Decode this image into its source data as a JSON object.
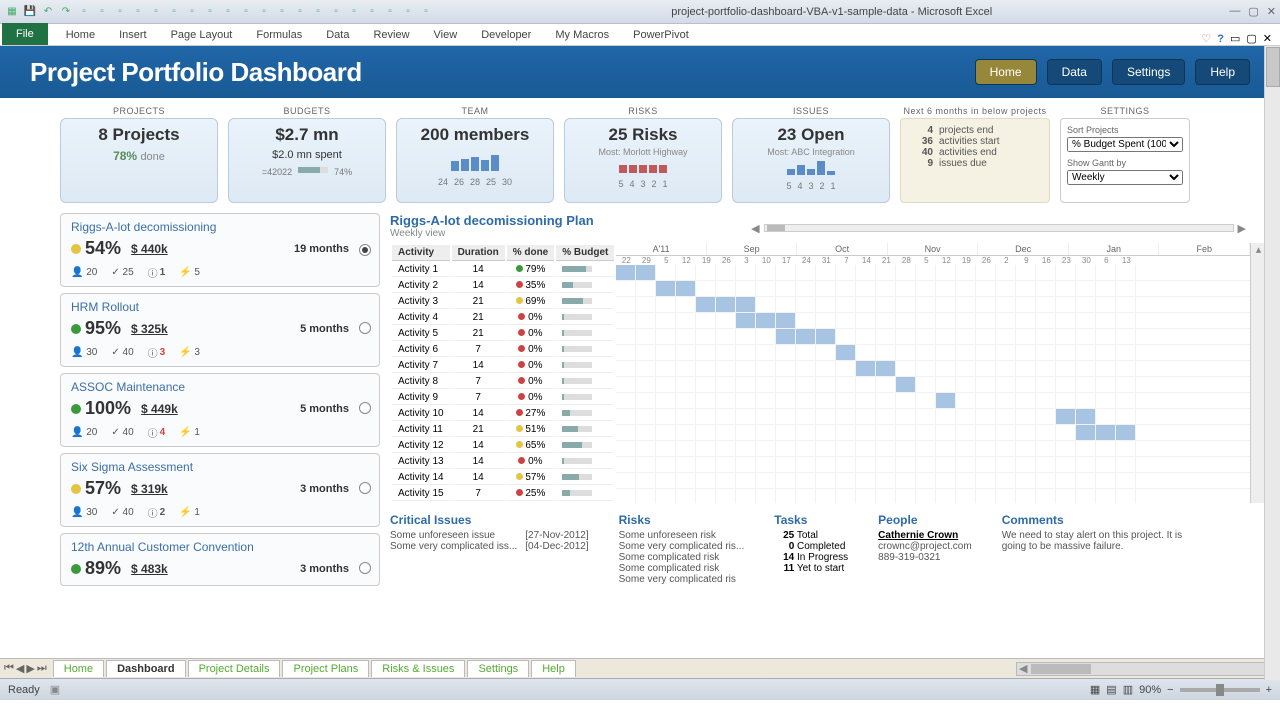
{
  "window": {
    "title": "project-portfolio-dashboard-VBA-v1-sample-data  -  Microsoft Excel"
  },
  "ribbon": {
    "file": "File",
    "tabs": [
      "Home",
      "Insert",
      "Page Layout",
      "Formulas",
      "Data",
      "Review",
      "View",
      "Developer",
      "My Macros",
      "PowerPivot"
    ]
  },
  "header": {
    "title": "Project Portfolio Dashboard",
    "btns": {
      "home": "Home",
      "data": "Data",
      "settings": "Settings",
      "help": "Help"
    }
  },
  "kpi": {
    "projects": {
      "label": "PROJECTS",
      "main": "8 Projects",
      "pct": "78%",
      "done": "done"
    },
    "budgets": {
      "label": "BUDGETS",
      "main": "$2.7 mn",
      "spent": "$2.0 mn spent",
      "bar_label": "=42022",
      "pct": "74%"
    },
    "team": {
      "label": "TEAM",
      "main": "200 members",
      "ticks": [
        "24",
        "26",
        "28",
        "25",
        "30"
      ]
    },
    "risks": {
      "label": "RISKS",
      "main": "25 Risks",
      "most": "Most: Morlott Highway",
      "ticks": [
        "5",
        "4",
        "3",
        "2",
        "1"
      ]
    },
    "issues": {
      "label": "ISSUES",
      "main": "23 Open",
      "most": "Most: ABC Integration",
      "ticks": [
        "5",
        "4",
        "3",
        "2",
        "1"
      ]
    },
    "next6": {
      "label": "Next 6 months in below projects",
      "rows": [
        {
          "n": "4",
          "t": "projects end"
        },
        {
          "n": "36",
          "t": "activities start"
        },
        {
          "n": "40",
          "t": "activities end"
        },
        {
          "n": "9",
          "t": "issues due"
        }
      ]
    },
    "settings": {
      "label": "SETTINGS",
      "sort_lbl": "Sort Projects",
      "sort_val": "% Budget Spent (100",
      "gantt_lbl": "Show Gantt by",
      "gantt_val": "Weekly"
    }
  },
  "projects": [
    {
      "name": "Riggs-A-lot decomissioning",
      "pct": "54%",
      "dot": "y",
      "budget": "$ 440k",
      "dur": "19 months",
      "team": "20",
      "tasks": "25",
      "risks": "1",
      "issues": "5",
      "sel": true
    },
    {
      "name": "HRM Rollout",
      "pct": "95%",
      "dot": "g",
      "budget": "$ 325k",
      "dur": "5 months",
      "team": "30",
      "tasks": "40",
      "risks": "3",
      "issues": "3",
      "rred": true,
      "sel": false
    },
    {
      "name": "ASSOC Maintenance",
      "pct": "100%",
      "dot": "g",
      "budget": "$ 449k",
      "dur": "5 months",
      "team": "20",
      "tasks": "40",
      "risks": "4",
      "issues": "1",
      "rred": true,
      "sel": false
    },
    {
      "name": "Six Sigma Assessment",
      "pct": "57%",
      "dot": "y",
      "budget": "$ 319k",
      "dur": "3 months",
      "team": "30",
      "tasks": "40",
      "risks": "2",
      "issues": "1",
      "sel": false
    },
    {
      "name": "12th Annual Customer Convention",
      "pct": "89%",
      "dot": "g",
      "budget": "$ 483k",
      "dur": "3 months",
      "team": "",
      "tasks": "",
      "risks": "",
      "issues": "",
      "sel": false
    }
  ],
  "plan": {
    "title": "Riggs-A-lot decomissioning Plan",
    "view": "Weekly view",
    "cols": [
      "Activity",
      "Duration",
      "% done",
      "% Budget"
    ],
    "months": [
      "A'11",
      "Sep",
      "Oct",
      "Nov",
      "Dec",
      "Jan",
      "Feb"
    ],
    "days": [
      "22",
      "29",
      "5",
      "12",
      "19",
      "26",
      "3",
      "10",
      "17",
      "24",
      "31",
      "7",
      "14",
      "21",
      "28",
      "5",
      "12",
      "19",
      "26",
      "2",
      "9",
      "16",
      "23",
      "30",
      "6",
      "13"
    ],
    "rows": [
      {
        "a": "Activity 1",
        "d": "14",
        "dot": "g",
        "p": "79%",
        "g": [
          0,
          1
        ]
      },
      {
        "a": "Activity 2",
        "d": "14",
        "dot": "r",
        "p": "35%",
        "g": [
          2,
          3
        ]
      },
      {
        "a": "Activity 3",
        "d": "21",
        "dot": "y",
        "p": "69%",
        "g": [
          4,
          6
        ]
      },
      {
        "a": "Activity 4",
        "d": "21",
        "dot": "r",
        "p": "0%",
        "g": [
          6,
          8
        ]
      },
      {
        "a": "Activity 5",
        "d": "21",
        "dot": "r",
        "p": "0%",
        "g": [
          8,
          10
        ]
      },
      {
        "a": "Activity 6",
        "d": "7",
        "dot": "r",
        "p": "0%",
        "g": [
          11,
          11
        ]
      },
      {
        "a": "Activity 7",
        "d": "14",
        "dot": "r",
        "p": "0%",
        "g": [
          12,
          13
        ]
      },
      {
        "a": "Activity 8",
        "d": "7",
        "dot": "r",
        "p": "0%",
        "g": [
          14,
          14
        ]
      },
      {
        "a": "Activity 9",
        "d": "7",
        "dot": "r",
        "p": "0%",
        "g": [
          16,
          16
        ]
      },
      {
        "a": "Activity 10",
        "d": "14",
        "dot": "r",
        "p": "27%",
        "g": [
          22,
          23
        ]
      },
      {
        "a": "Activity 11",
        "d": "21",
        "dot": "y",
        "p": "51%",
        "g": [
          23,
          25
        ]
      },
      {
        "a": "Activity 12",
        "d": "14",
        "dot": "y",
        "p": "65%",
        "g": []
      },
      {
        "a": "Activity 13",
        "d": "14",
        "dot": "r",
        "p": "0%",
        "g": []
      },
      {
        "a": "Activity 14",
        "d": "14",
        "dot": "y",
        "p": "57%",
        "g": []
      },
      {
        "a": "Activity 15",
        "d": "7",
        "dot": "r",
        "p": "25%",
        "g": []
      }
    ]
  },
  "details": {
    "issues": {
      "h": "Critical Issues",
      "rows": [
        {
          "t": "Some unforeseen issue",
          "d": "[27-Nov-2012]"
        },
        {
          "t": "Some very complicated iss...",
          "d": "[04-Dec-2012]"
        }
      ]
    },
    "risks": {
      "h": "Risks",
      "rows": [
        "Some unforeseen risk",
        "Some very complicated ris...",
        "Some complicated risk",
        "Some complicated risk",
        "Some very complicated ris"
      ]
    },
    "tasks": {
      "h": "Tasks",
      "rows": [
        {
          "n": "25",
          "t": "Total"
        },
        {
          "n": "0",
          "t": "Completed"
        },
        {
          "n": "14",
          "t": "In Progress"
        },
        {
          "n": "11",
          "t": "Yet to start"
        }
      ]
    },
    "people": {
      "h": "People",
      "name": "Cathernie Crown",
      "email": "crownc@project.com",
      "phone": "889-319-0321"
    },
    "comments": {
      "h": "Comments",
      "text": "We need to stay alert on this project. It is going to be massive failure."
    }
  },
  "sheets": [
    "Home",
    "Dashboard",
    "Project Details",
    "Project Plans",
    "Risks & Issues",
    "Settings",
    "Help"
  ],
  "status": {
    "ready": "Ready",
    "zoom": "90%"
  }
}
